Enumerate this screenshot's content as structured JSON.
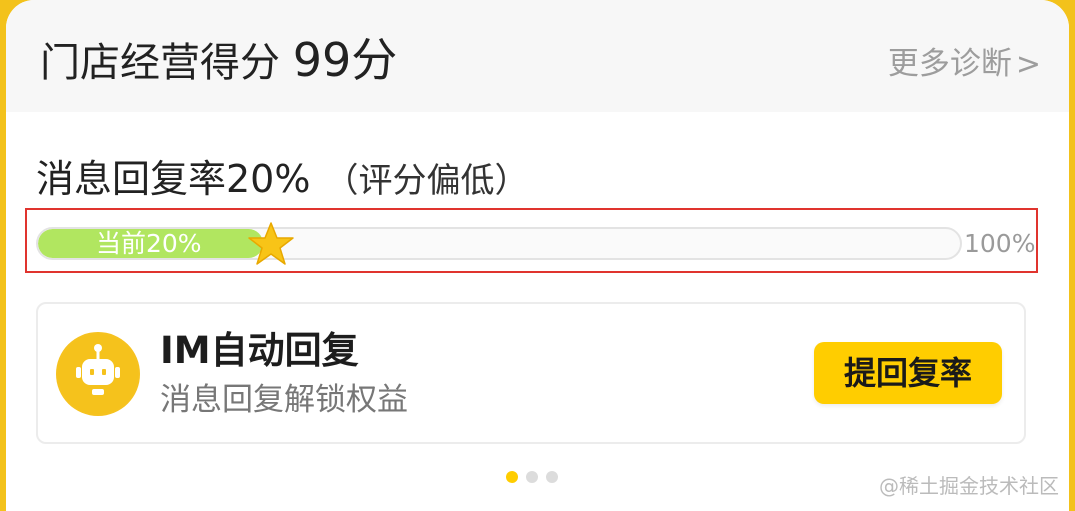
{
  "header": {
    "title": "门店经营得分",
    "score": "99分",
    "more_link": "更多诊断"
  },
  "metric": {
    "label": "消息回复率20%",
    "note": "（评分偏低）",
    "progress": 0.2,
    "current_label": "当前20%",
    "max_label": "100%"
  },
  "feature": {
    "icon": "robot-icon",
    "title": "IM自动回复",
    "subtitle": "消息回复解锁权益",
    "button": "提回复率"
  },
  "pagination": {
    "total": 3,
    "active": 0
  },
  "watermark": "@稀土掘金技术社区",
  "colors": {
    "accent": "#ffcd00",
    "progress": "#b1e660",
    "highlight": "#e0342e"
  }
}
